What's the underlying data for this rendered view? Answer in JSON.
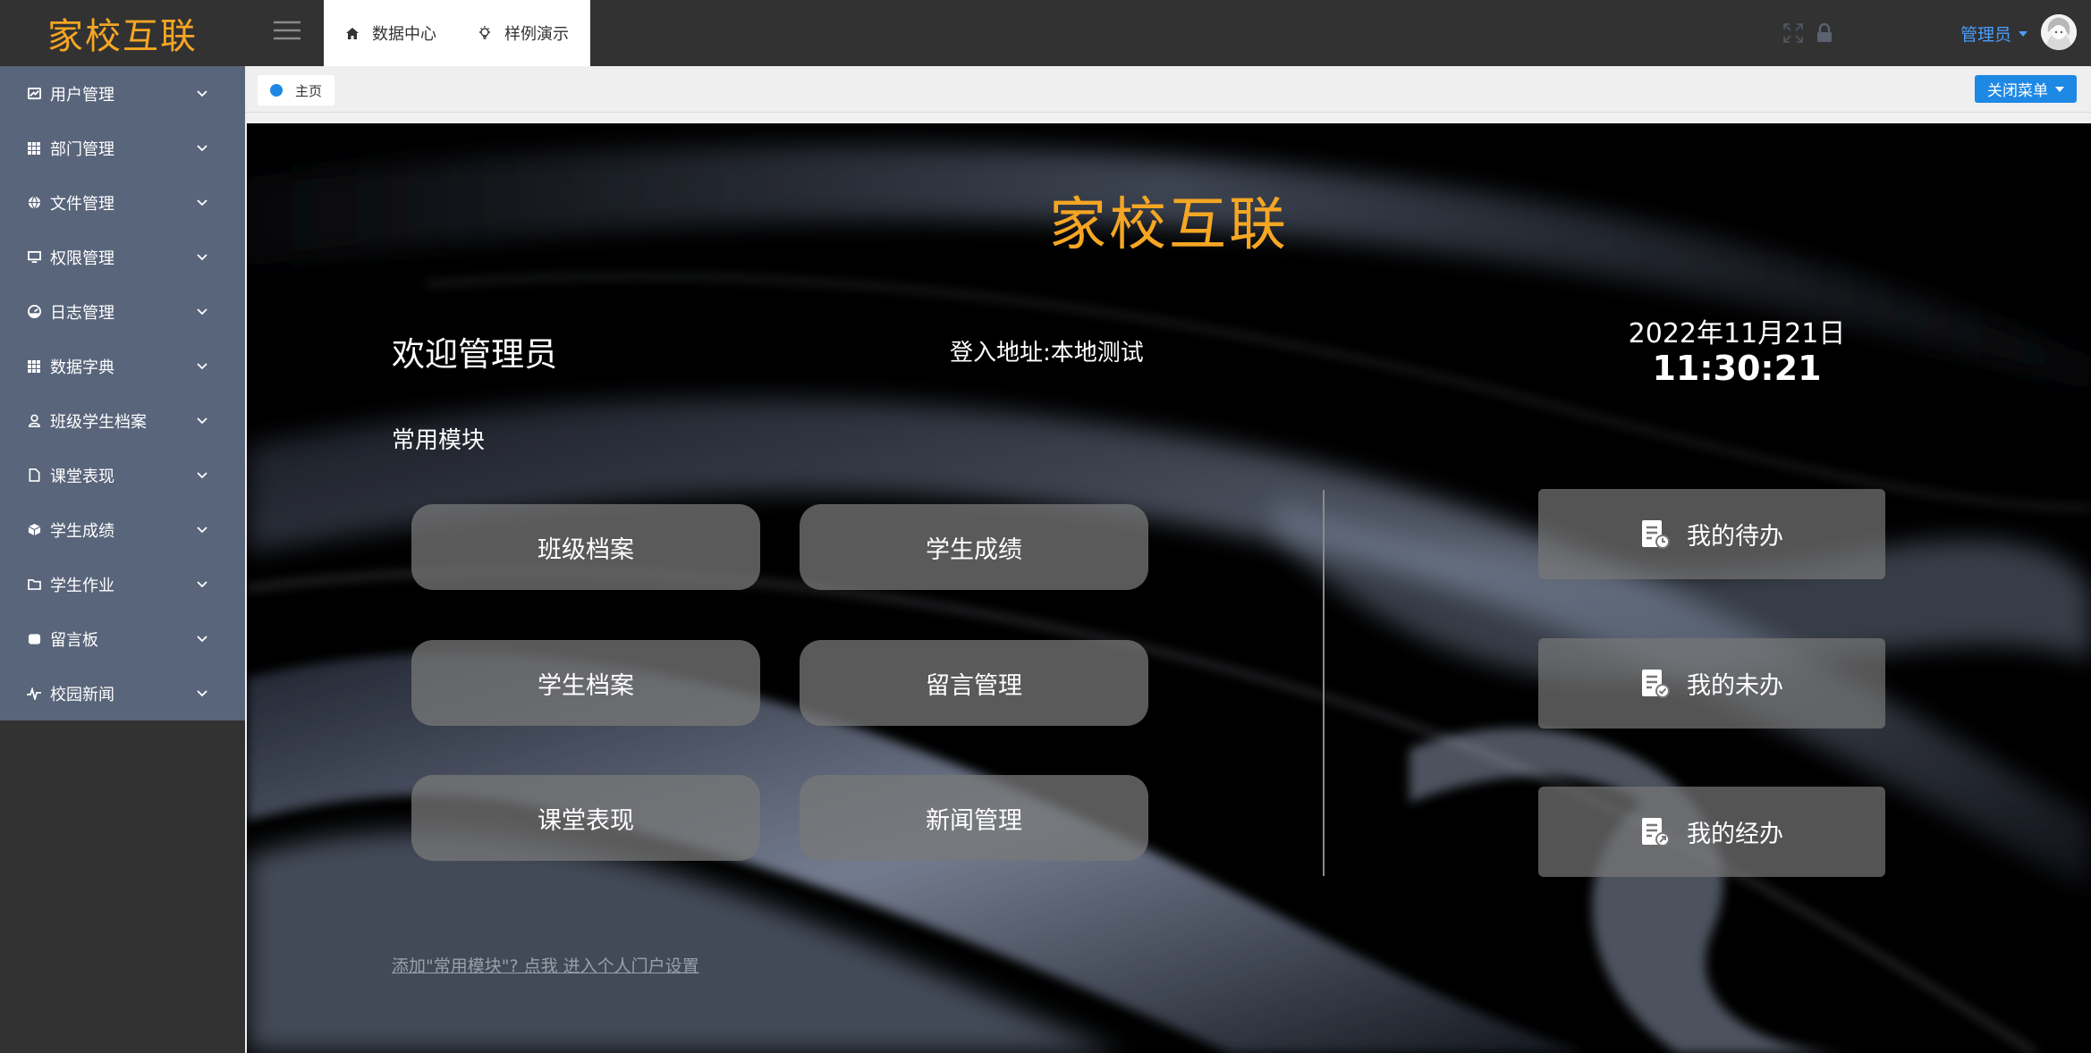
{
  "app": {
    "logo": "家校互联"
  },
  "sidebar": {
    "items": [
      {
        "label": "用户管理",
        "icon": "chart-icon"
      },
      {
        "label": "部门管理",
        "icon": "grid-icon"
      },
      {
        "label": "文件管理",
        "icon": "globe-icon"
      },
      {
        "label": "权限管理",
        "icon": "monitor-icon"
      },
      {
        "label": "日志管理",
        "icon": "dashboard-icon"
      },
      {
        "label": "数据字典",
        "icon": "grid-icon"
      },
      {
        "label": "班级学生档案",
        "icon": "user-icon"
      },
      {
        "label": "课堂表现",
        "icon": "file-icon"
      },
      {
        "label": "学生成绩",
        "icon": "cube-icon"
      },
      {
        "label": "学生作业",
        "icon": "folder-icon"
      },
      {
        "label": "留言板",
        "icon": "message-icon"
      },
      {
        "label": "校园新闻",
        "icon": "pulse-icon"
      }
    ]
  },
  "header": {
    "tabs": [
      {
        "label": "数据中心",
        "icon": "home-icon"
      },
      {
        "label": "样例演示",
        "icon": "bulb-icon"
      }
    ],
    "user_label": "管理员"
  },
  "breadcrumb": {
    "home_label": "主页",
    "close_menu_label": "关闭菜单"
  },
  "main": {
    "title": "家校互联",
    "welcome": "欢迎管理员",
    "login_label": "登入地址:",
    "login_value": "本地测试",
    "date": "2022年11月21日",
    "time": "11:30:21",
    "modules_title": "常用模块",
    "modules": [
      "班级档案",
      "学生成绩",
      "学生档案",
      "留言管理",
      "课堂表现",
      "新闻管理"
    ],
    "todos": [
      "我的待办",
      "我的未办",
      "我的经办"
    ],
    "portal_link": "添加\"常用模块\"? 点我 进入个人门户设置"
  },
  "colors": {
    "accent_orange": "#f5a623",
    "primary_blue": "#1e88e5",
    "sidebar_menu": "#59657b",
    "dark": "#323232"
  }
}
